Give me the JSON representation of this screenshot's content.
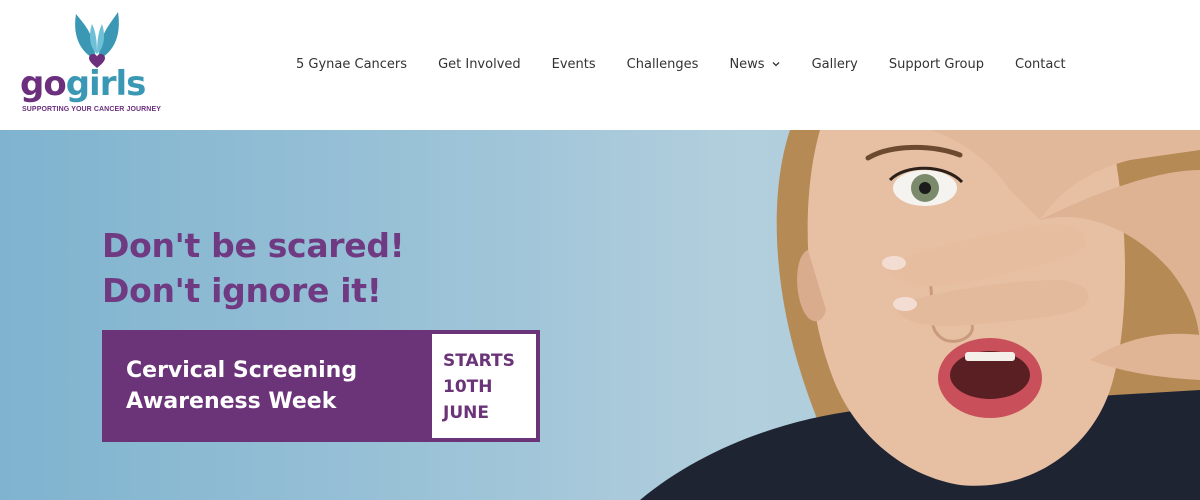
{
  "logo": {
    "go": "go",
    "girls": "girls",
    "tagline": "SUPPORTING YOUR CANCER JOURNEY",
    "colors": {
      "purple": "#6b2f7d",
      "teal": "#3a98b4"
    }
  },
  "nav": {
    "items": [
      {
        "label": "5 Gynae Cancers"
      },
      {
        "label": "Get Involved"
      },
      {
        "label": "Events"
      },
      {
        "label": "Challenges"
      },
      {
        "label": "News",
        "has_dropdown": true,
        "dropdown_icon": "chevron-down-icon"
      },
      {
        "label": "Gallery"
      },
      {
        "label": "Support Group"
      },
      {
        "label": "Contact"
      }
    ]
  },
  "hero": {
    "headline_line1": "Don't be scared!",
    "headline_line2": "Don't ignore it!",
    "banner_line1": "Cervical Screening",
    "banner_line2": "Awareness Week",
    "date_line1": "STARTS",
    "date_line2": "10TH",
    "date_line3": "JUNE",
    "colors": {
      "accent_purple": "#6b3478",
      "background_blue": "#9ec4d8"
    }
  }
}
